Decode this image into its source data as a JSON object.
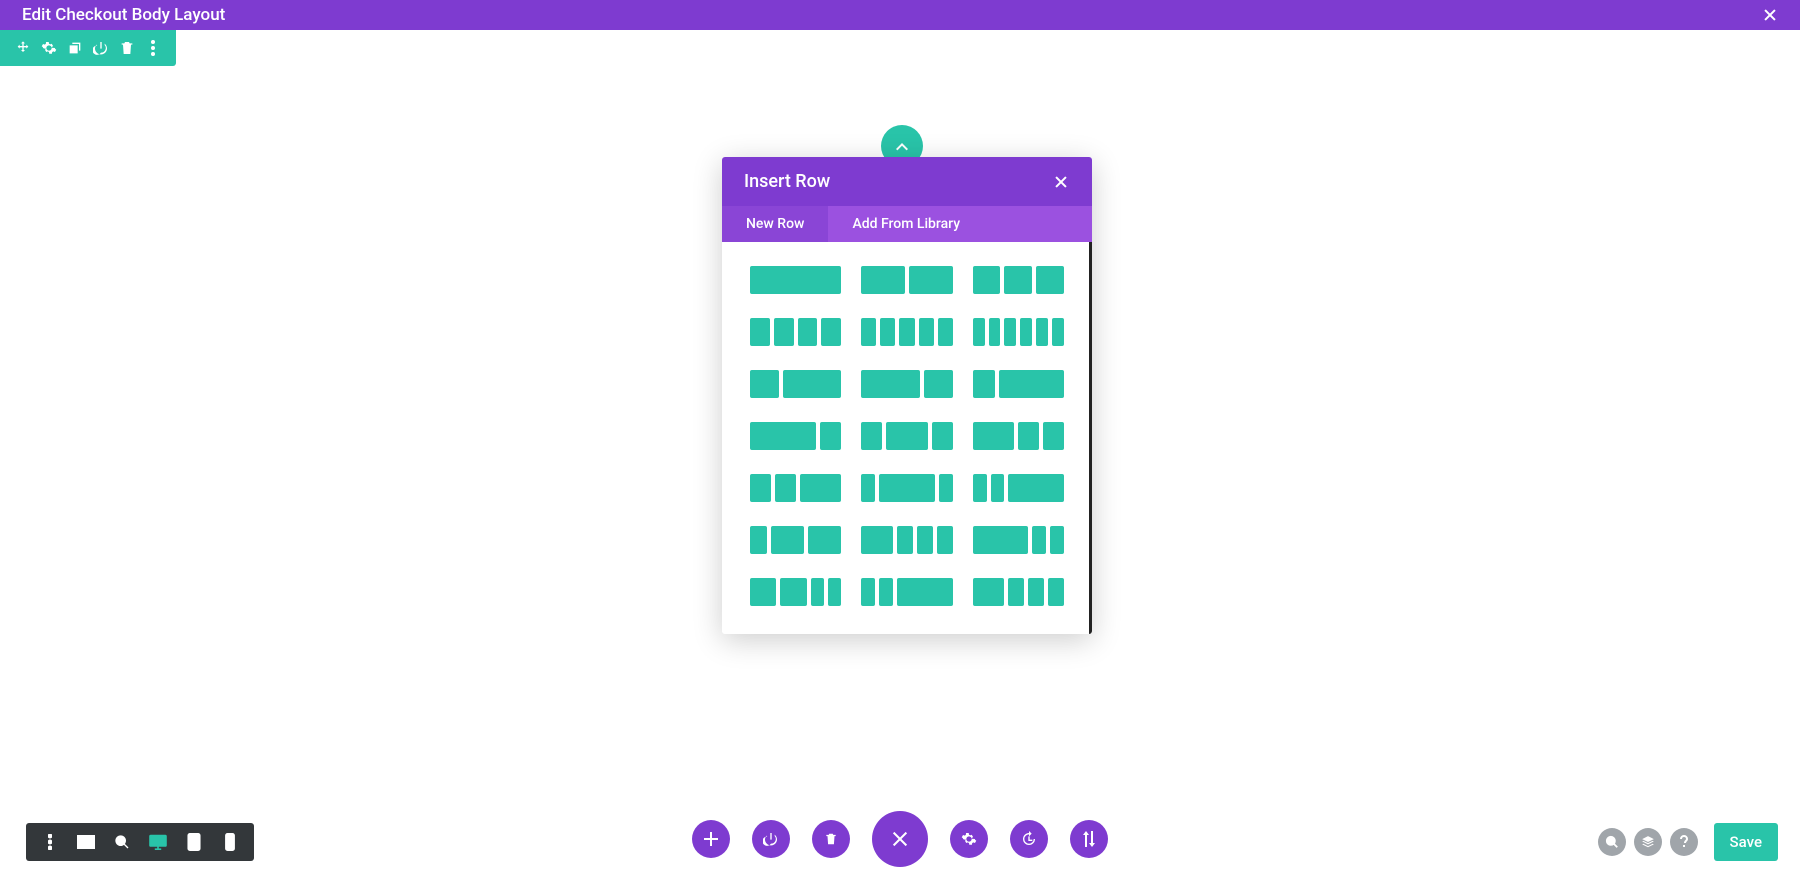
{
  "topbar": {
    "title": "Edit Checkout Body Layout"
  },
  "section_toolbar_icons": [
    "move",
    "settings",
    "duplicate",
    "power",
    "delete",
    "more"
  ],
  "popover": {
    "title": "Insert Row",
    "tabs": {
      "new_row": "New Row",
      "add_from_library": "Add From Library"
    },
    "active_tab": "new_row",
    "layouts": [
      [
        1
      ],
      [
        1,
        1
      ],
      [
        1,
        1,
        1
      ],
      [
        1,
        1,
        1,
        1
      ],
      [
        1,
        1,
        1,
        1,
        1
      ],
      [
        1,
        1,
        1,
        1,
        1,
        1
      ],
      [
        1,
        2
      ],
      [
        2,
        1
      ],
      [
        1,
        3
      ],
      [
        3,
        1
      ],
      [
        1,
        2,
        1
      ],
      [
        2,
        1,
        1
      ],
      [
        1,
        1,
        2
      ],
      [
        1,
        4,
        1
      ],
      [
        1,
        1,
        4
      ],
      [
        1,
        2,
        2
      ],
      [
        2,
        1,
        1,
        1
      ],
      [
        4,
        1,
        1
      ],
      [
        2,
        2,
        1,
        1
      ],
      [
        1,
        1,
        4
      ],
      [
        2,
        1,
        1,
        1
      ]
    ]
  },
  "bottom_center_icons": [
    "plus",
    "power",
    "delete",
    "close",
    "settings",
    "history",
    "sort"
  ],
  "bottom_right": {
    "save": "Save"
  }
}
